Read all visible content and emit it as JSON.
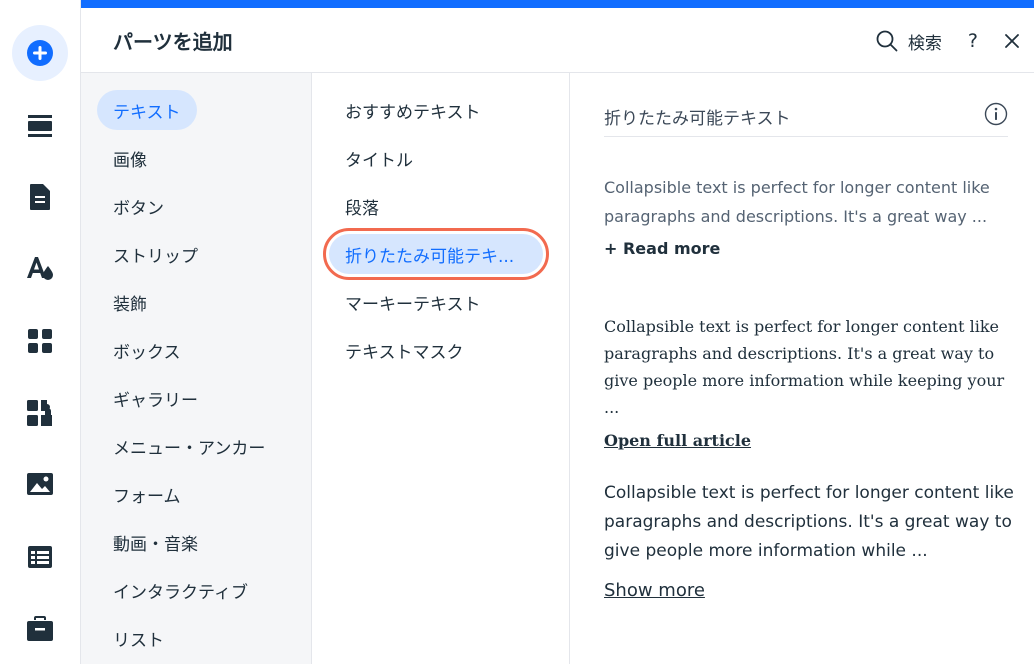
{
  "header": {
    "title": "パーツを追加",
    "search_label": "検索",
    "help_label": "?"
  },
  "rail": {
    "items": [
      {
        "icon": "add-plus-icon",
        "active": true
      },
      {
        "icon": "sections-icon"
      },
      {
        "icon": "pages-icon"
      },
      {
        "icon": "design-theme-icon"
      },
      {
        "icon": "apps-grid-icon"
      },
      {
        "icon": "puzzle-plugin-icon"
      },
      {
        "icon": "media-image-icon"
      },
      {
        "icon": "cms-table-icon"
      },
      {
        "icon": "portfolio-briefcase-icon"
      }
    ]
  },
  "categories": [
    {
      "label": "テキスト",
      "selected": true
    },
    {
      "label": "画像"
    },
    {
      "label": "ボタン"
    },
    {
      "label": "ストリップ"
    },
    {
      "label": "装飾"
    },
    {
      "label": "ボックス"
    },
    {
      "label": "ギャラリー"
    },
    {
      "label": "メニュー・アンカー"
    },
    {
      "label": "フォーム"
    },
    {
      "label": "動画・音楽"
    },
    {
      "label": "インタラクティブ"
    },
    {
      "label": "リスト"
    }
  ],
  "subitems": [
    {
      "label": "おすすめテキスト"
    },
    {
      "label": "タイトル"
    },
    {
      "label": "段落"
    },
    {
      "label": "折りたたみ可能テキ...",
      "selected": true
    },
    {
      "label": "マーキーテキスト"
    },
    {
      "label": "テキストマスク"
    }
  ],
  "preview": {
    "title": "折りたたみ可能テキスト",
    "cards": [
      {
        "body": "Collapsible text is perfect for longer content like paragraphs and descriptions. It's a great way ...",
        "link": "+ Read more"
      },
      {
        "body": "Collapsible text is perfect for longer content like paragraphs and descriptions. It's a great way to give people more information while keeping your ...",
        "link": "Open full article"
      },
      {
        "body": "Collapsible text is perfect for longer content like paragraphs and descriptions. It's a great way to give people more information while ...",
        "link": "Show more"
      }
    ]
  },
  "colors": {
    "accent": "#116dff",
    "highlight_outline": "#f26a4f",
    "selected_bg": "#d6e6fe"
  }
}
